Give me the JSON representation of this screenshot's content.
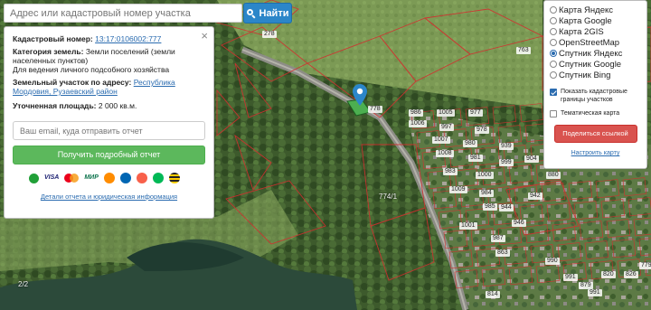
{
  "search": {
    "placeholder": "Адрес или кадастровый номер участка",
    "button_label": "Найти"
  },
  "info": {
    "cadastral_label": "Кадастровый номер:",
    "cadastral_value": "13:17:0106002:777",
    "category_label": "Категория земель:",
    "category_value": "Земли поселений (земли населенных пунктов)",
    "use_value": "Для ведения личного подсобного хозяйства",
    "address_label": "Земельный участок по адресу:",
    "address_value": "Республика Мордовия, Рузаевский район",
    "area_label": "Уточненная площадь:",
    "area_value": "2 000 кв.м.",
    "email_placeholder": "Ваш email, куда отправить отчет",
    "report_button": "Получить подробный отчет",
    "details_link": "Детали отчета и юридическая информация",
    "payment_methods": [
      "sber-icon",
      "VISA",
      "mastercard-icon",
      "МИР",
      "qiwi-icon",
      "webmoney-icon",
      "yandex-money-icon",
      "megafon-icon",
      "beeline-icon"
    ]
  },
  "layers": {
    "options": [
      {
        "label": "Карта Яндекс",
        "selected": false
      },
      {
        "label": "Карта Google",
        "selected": false
      },
      {
        "label": "Карта 2GIS",
        "selected": false
      },
      {
        "label": "OpenStreetMap",
        "selected": false
      },
      {
        "label": "Спутник Яндекс",
        "selected": true
      },
      {
        "label": "Спутник Google",
        "selected": false
      },
      {
        "label": "Спутник Bing",
        "selected": false
      }
    ],
    "show_cadastral": {
      "label": "Показать кадастровые границы участков",
      "checked": true
    },
    "thematic": {
      "label": "Тематическая карта",
      "checked": false
    },
    "share_button": "Поделиться ссылкой",
    "setup_link": "Настроить карту"
  },
  "map": {
    "parcel_labels": [
      "278",
      "763",
      "278",
      "778",
      "986",
      "1005",
      "977",
      "1006",
      "997",
      "978",
      "1007",
      "980",
      "939",
      "904",
      "880",
      "1008",
      "981",
      "999",
      "942",
      "983",
      "1000",
      "944",
      "1009",
      "984",
      "985",
      "1001",
      "946",
      "987",
      "990",
      "991",
      "863",
      "879",
      "991",
      "820",
      "826",
      "774/1",
      "814",
      "2/2",
      "779"
    ]
  }
}
